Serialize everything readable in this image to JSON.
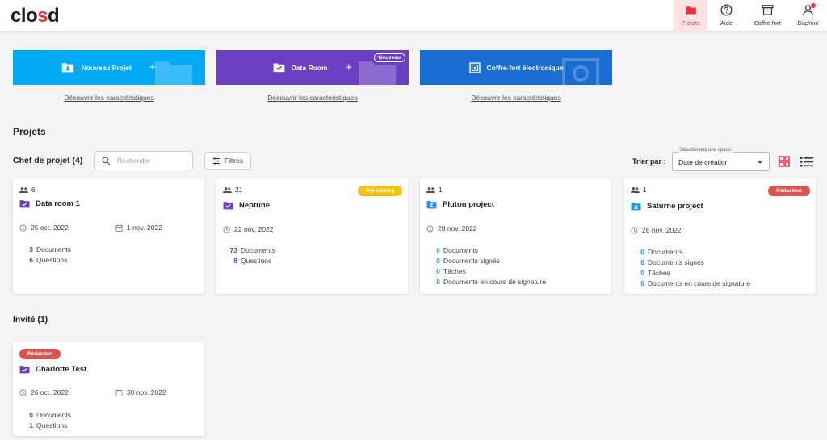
{
  "app": {
    "logo": "closd"
  },
  "nav": {
    "items": [
      {
        "label": "Projets",
        "icon": "folder-icon",
        "active": true
      },
      {
        "label": "Aide",
        "icon": "help-icon"
      },
      {
        "label": "Coffre fort",
        "icon": "archive-icon"
      },
      {
        "label": "Daphné",
        "icon": "user-icon"
      }
    ]
  },
  "tiles": [
    {
      "label": "Nouveau Projet",
      "icon": "folder-user-icon",
      "color": "#03a9f4",
      "link": "Découvrir les caractéristiques"
    },
    {
      "label": "Data Room",
      "icon": "folder-check-icon",
      "color": "#6b3fc2",
      "badge": "Nouveau",
      "link": "Découvrir les caractéristiques"
    },
    {
      "label": "Coffre-fort électronique",
      "icon": "safe-icon",
      "color": "#1b6ed1",
      "link": "Découvrir les caractéristiques"
    }
  ],
  "page_title": "Projets",
  "owner_section": {
    "title": "Chef de projet (4)",
    "search_placeholder": "Recherche",
    "filter_label": "Filtres",
    "sort_label": "Trier par :",
    "sort_float_label": "Sélectionnez une option",
    "sort_value": "Date de création"
  },
  "owner_cards": [
    {
      "members": "6",
      "title": "Data room 1",
      "icon": "folder-check-icon",
      "date_start": "25 oct. 2022",
      "date_end": "1 nov. 2022",
      "stats": [
        {
          "n": "3",
          "label": "Documents"
        },
        {
          "n": "6",
          "label": "Questions"
        }
      ]
    },
    {
      "members": "21",
      "title": "Neptune",
      "icon": "folder-check-icon",
      "badge": "Pré-closing",
      "date_start": "22 nov. 2022",
      "stats": [
        {
          "n": "73",
          "label": "Documents"
        },
        {
          "n": "8",
          "label": "Questions"
        }
      ]
    },
    {
      "members": "1",
      "title": "Pluton project",
      "icon": "folder-user-icon",
      "date_start": "28 nov. 2022",
      "stats": [
        {
          "n": "0",
          "label": "Documents"
        },
        {
          "n": "0",
          "label": "Documents signés"
        },
        {
          "n": "0",
          "label": "Tâches"
        },
        {
          "n": "0",
          "label": "Documents en cours de signature"
        }
      ]
    },
    {
      "members": "1",
      "title": "Saturne project",
      "icon": "folder-user-icon",
      "badge": "Rédaction",
      "date_start": "28 nov. 2022",
      "stats": [
        {
          "n": "0",
          "label": "Documents"
        },
        {
          "n": "0",
          "label": "Documents signés"
        },
        {
          "n": "0",
          "label": "Tâches"
        },
        {
          "n": "0",
          "label": "Documents en cours de signature"
        }
      ]
    }
  ],
  "guest_section": {
    "title": "Invité (1)"
  },
  "guest_cards": [
    {
      "title": "Charlotte Test",
      "icon": "folder-check-icon",
      "badge": "Rédaction",
      "date_start": "26 oct. 2022",
      "date_end": "30 nov. 2022",
      "stats": [
        {
          "n": "0",
          "label": "Documents"
        },
        {
          "n": "1",
          "label": "Questions"
        }
      ]
    }
  ],
  "colors": {
    "accent": "#e8353f",
    "purple": "#6b3fc2",
    "blue": "#1e9ae8",
    "yellow": "#f2c318",
    "red": "#d9534f"
  }
}
